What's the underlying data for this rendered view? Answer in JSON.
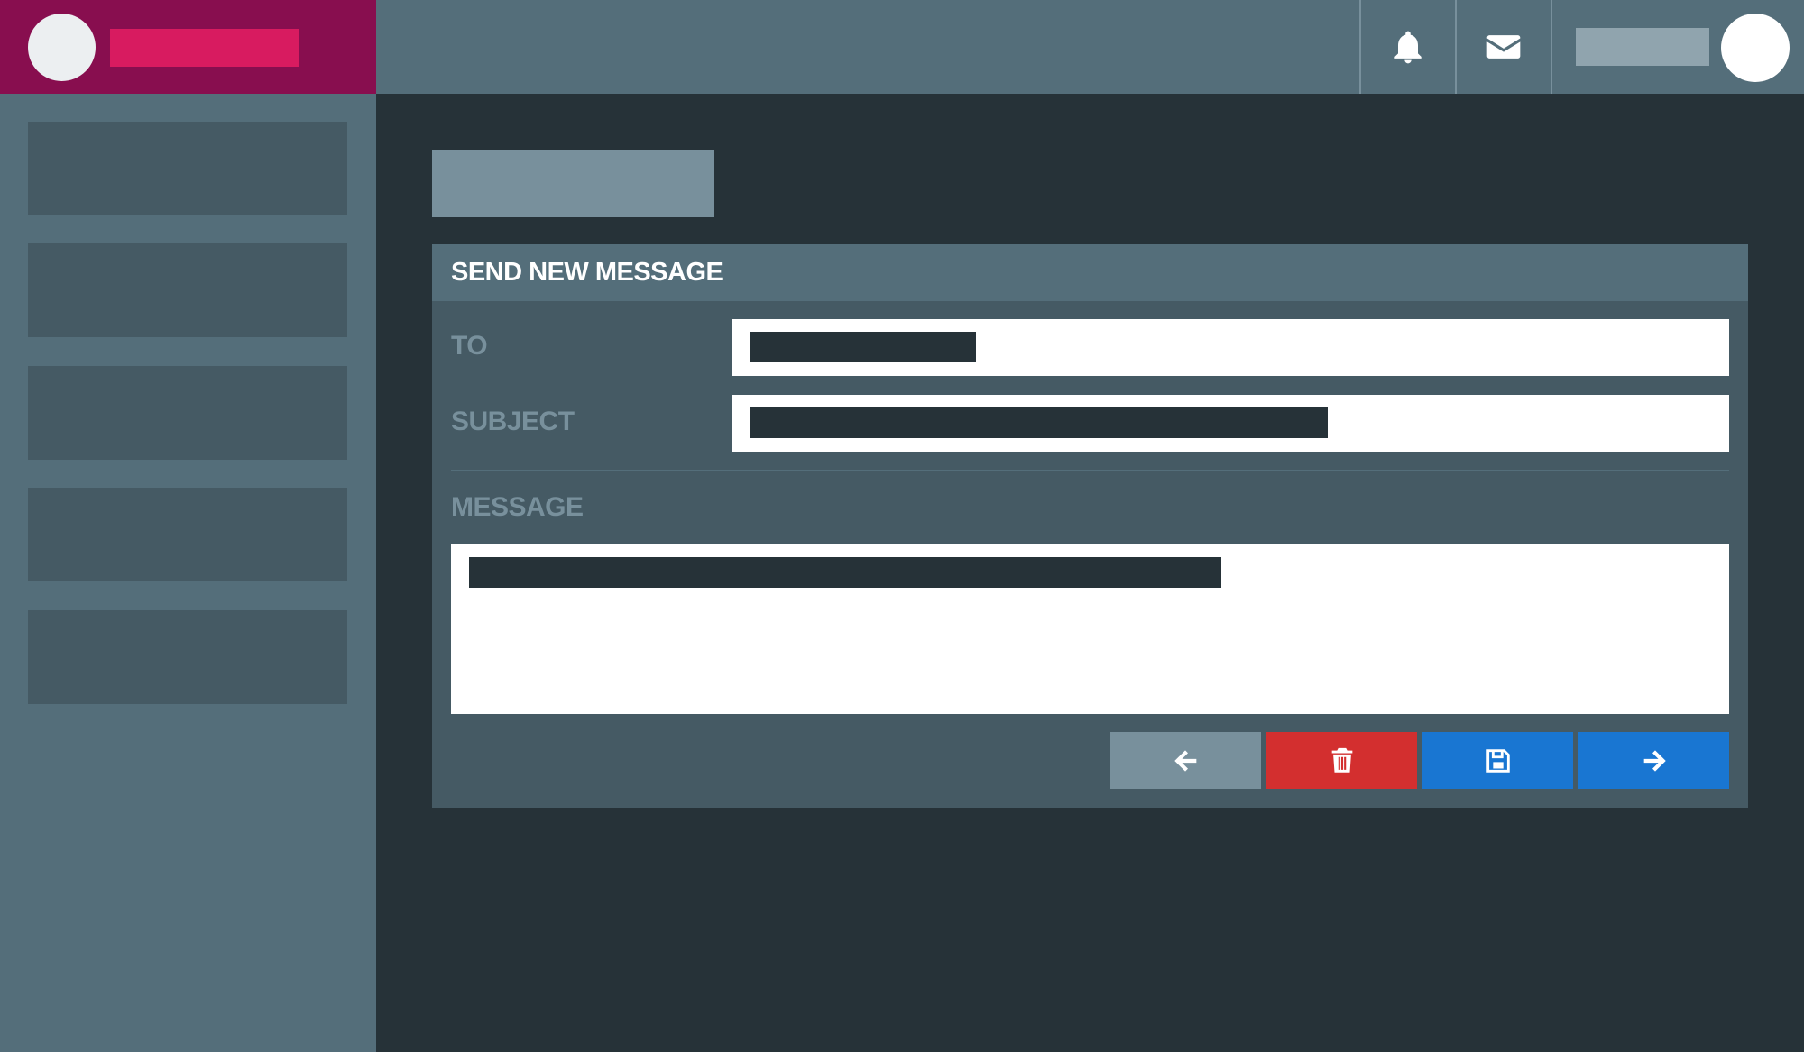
{
  "app": {
    "brand_name": "",
    "user_name": ""
  },
  "topbar": {
    "icons": [
      "bell-icon",
      "envelope-icon"
    ]
  },
  "sidebar": {
    "items": [
      {
        "label": ""
      },
      {
        "label": ""
      },
      {
        "label": ""
      },
      {
        "label": ""
      },
      {
        "label": ""
      }
    ]
  },
  "page": {
    "title": ""
  },
  "compose": {
    "header": "SEND NEW MESSAGE",
    "to_label": "TO",
    "to_value": "",
    "subject_label": "SUBJECT",
    "subject_value": "",
    "message_label": "MESSAGE",
    "message_value": "",
    "actions": [
      {
        "icon": "arrow-left-icon",
        "color": "#78909c"
      },
      {
        "icon": "trash-icon",
        "color": "#d32f2f"
      },
      {
        "icon": "floppy-disk-icon",
        "color": "#1976d2"
      },
      {
        "icon": "arrow-right-icon",
        "color": "#1976d2"
      }
    ]
  },
  "colors": {
    "brand_bg": "#880e4f",
    "brand_accent": "#d81b60",
    "topbar_bg": "#546e7a",
    "main_bg": "#263238",
    "panel_bg": "#455a64"
  }
}
